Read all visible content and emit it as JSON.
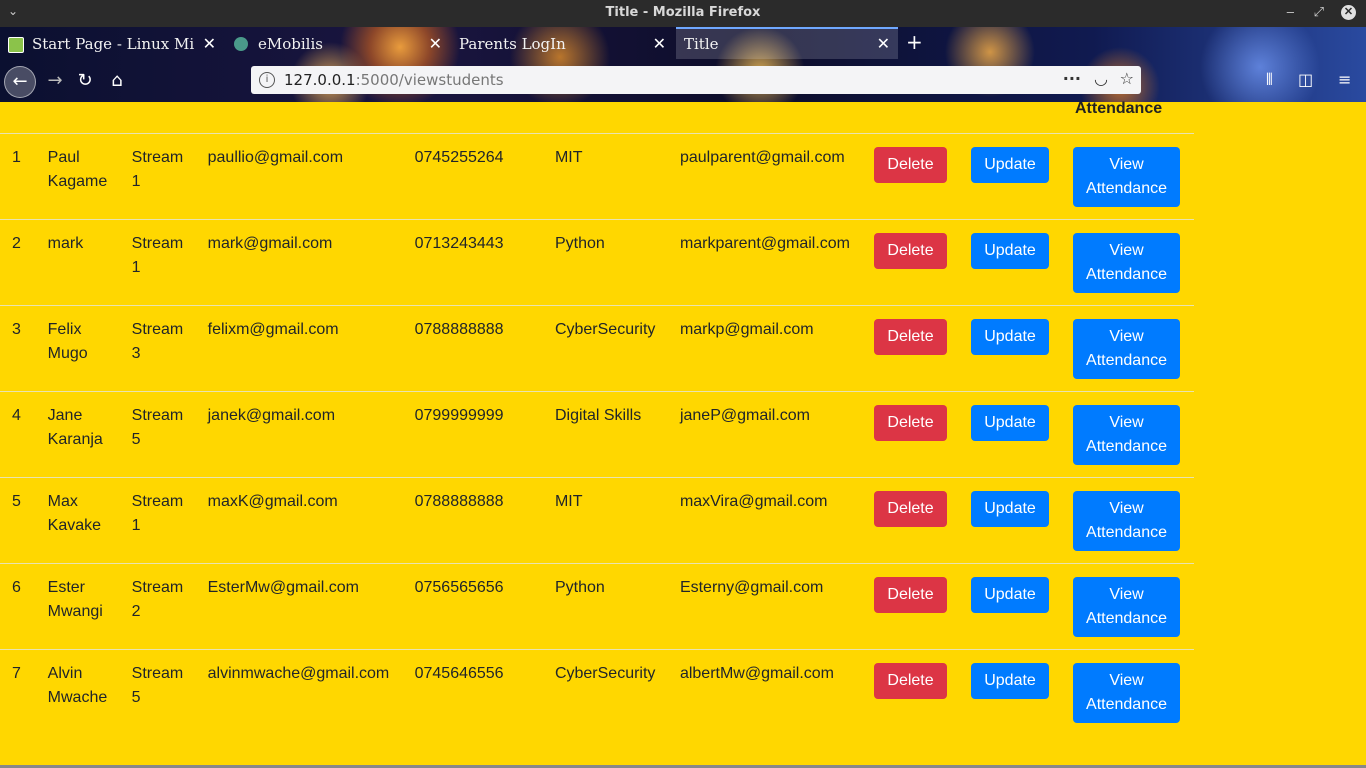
{
  "window": {
    "title": "Title - Mozilla Firefox",
    "menu_icon": "chevron-down-icon"
  },
  "tabs": [
    {
      "label": "Start Page - Linux Mi",
      "favicon": "linuxmint-icon",
      "active": false
    },
    {
      "label": "eMobilis",
      "favicon": "globe-icon",
      "active": false
    },
    {
      "label": "Parents LogIn",
      "favicon": "",
      "active": false
    },
    {
      "label": "Title",
      "favicon": "",
      "active": true
    }
  ],
  "address": {
    "host": "127.0.0.1",
    "rest": ":5000/viewstudents"
  },
  "table": {
    "partial_header": "Attendance",
    "rows": [
      {
        "id": "1",
        "name": "Paul Kagame",
        "stream": "Stream 1",
        "email": "paullio@gmail.com",
        "phone": "0745255264",
        "course": "MIT",
        "parent_email": "paulparent@gmail.com"
      },
      {
        "id": "2",
        "name": "mark",
        "stream": "Stream 1",
        "email": "mark@gmail.com",
        "phone": "0713243443",
        "course": "Python",
        "parent_email": "markparent@gmail.com"
      },
      {
        "id": "3",
        "name": "Felix Mugo",
        "stream": "Stream 3",
        "email": "felixm@gmail.com",
        "phone": "0788888888",
        "course": "CyberSecurity",
        "parent_email": "markp@gmail.com"
      },
      {
        "id": "4",
        "name": "Jane Karanja",
        "stream": "Stream 5",
        "email": "janek@gmail.com",
        "phone": "0799999999",
        "course": "Digital Skills",
        "parent_email": "janeP@gmail.com"
      },
      {
        "id": "5",
        "name": "Max Kavake",
        "stream": "Stream 1",
        "email": "maxK@gmail.com",
        "phone": "0788888888",
        "course": "MIT",
        "parent_email": "maxVira@gmail.com"
      },
      {
        "id": "6",
        "name": "Ester Mwangi",
        "stream": "Stream 2",
        "email": "EsterMw@gmail.com",
        "phone": "0756565656",
        "course": "Python",
        "parent_email": "Esterny@gmail.com"
      },
      {
        "id": "7",
        "name": "Alvin Mwache",
        "stream": "Stream 5",
        "email": "alvinmwache@gmail.com",
        "phone": "0745646556",
        "course": "CyberSecurity",
        "parent_email": "albertMw@gmail.com"
      }
    ],
    "actions": {
      "delete": "Delete",
      "update": "Update",
      "view_attendance": "View Attendance"
    }
  },
  "colors": {
    "page_bg": "#ffd700",
    "delete": "#dc3545",
    "primary": "#007bff"
  }
}
